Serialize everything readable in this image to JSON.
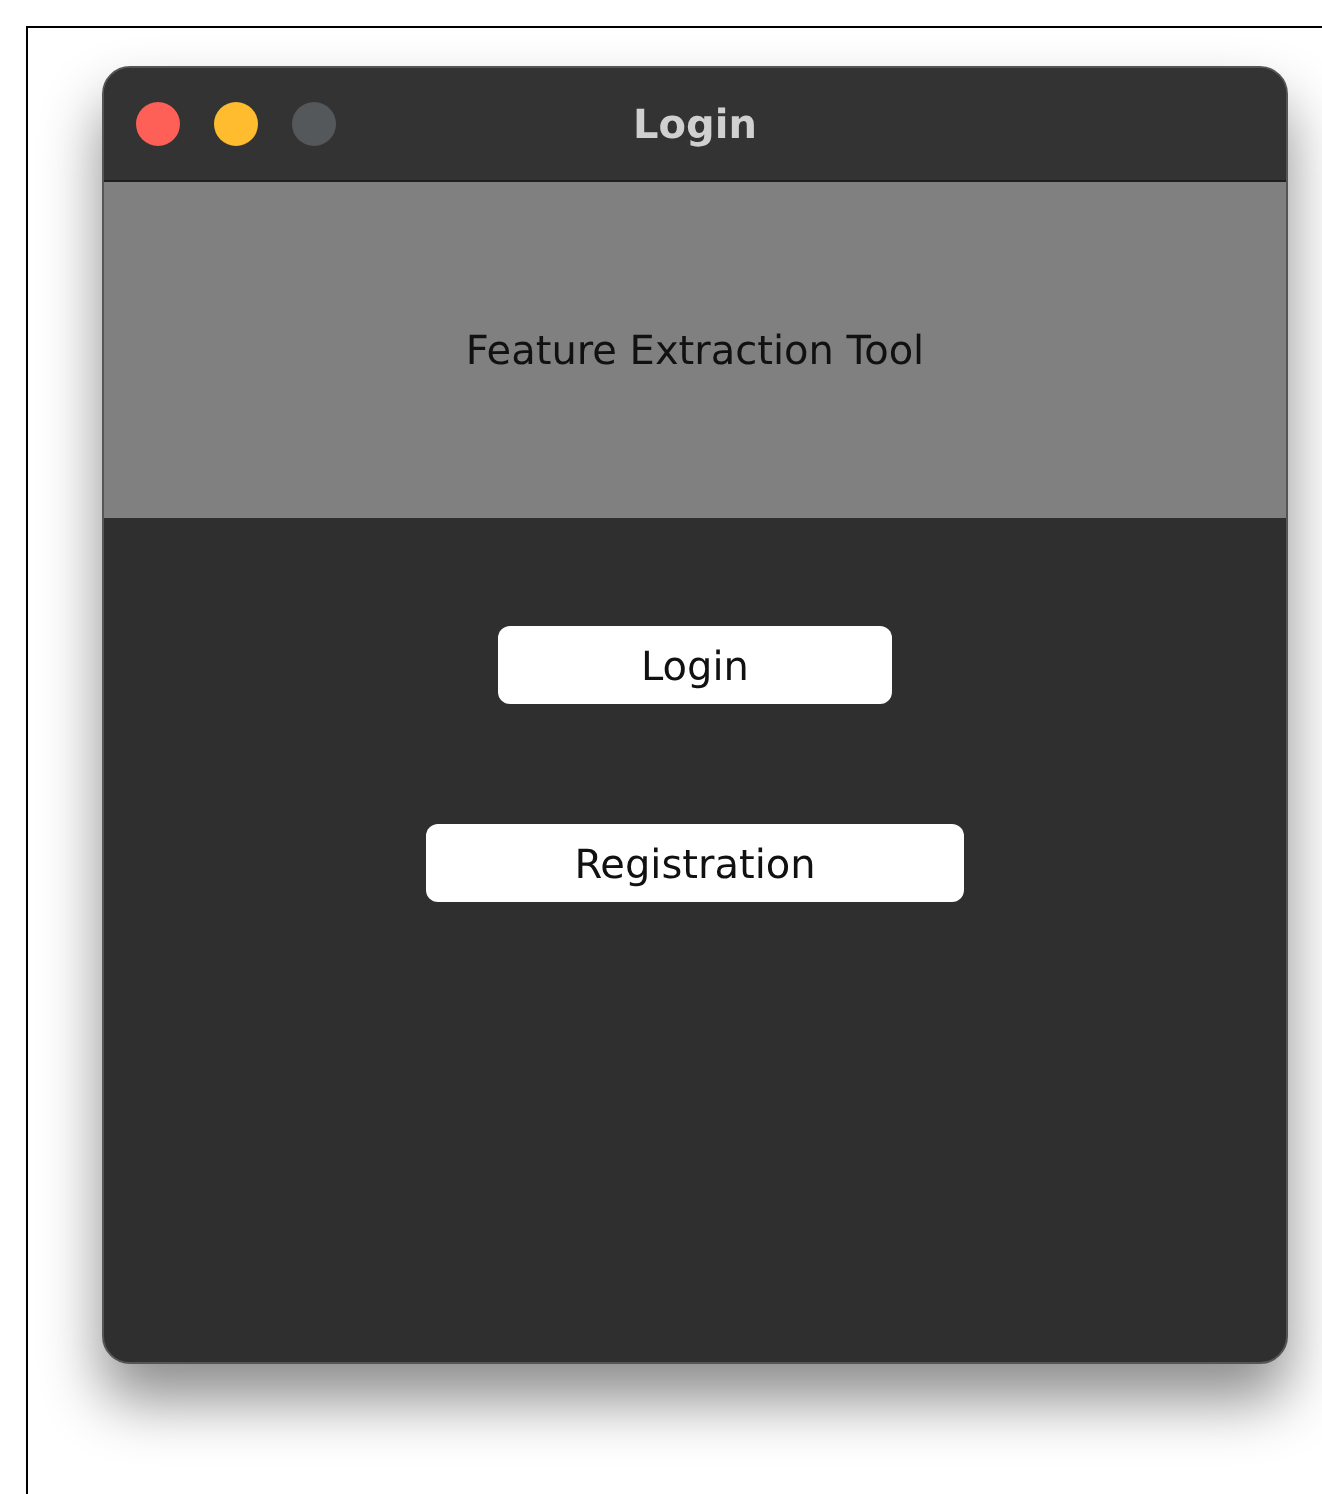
{
  "window": {
    "title": "Login",
    "controls": [
      {
        "color": "#fe5f57"
      },
      {
        "color": "#febc2e"
      },
      {
        "color": "#55585b"
      }
    ]
  },
  "header": {
    "title": "Feature Extraction Tool"
  },
  "buttons": [
    {
      "label": "Login"
    },
    {
      "label": "Registration"
    }
  ]
}
